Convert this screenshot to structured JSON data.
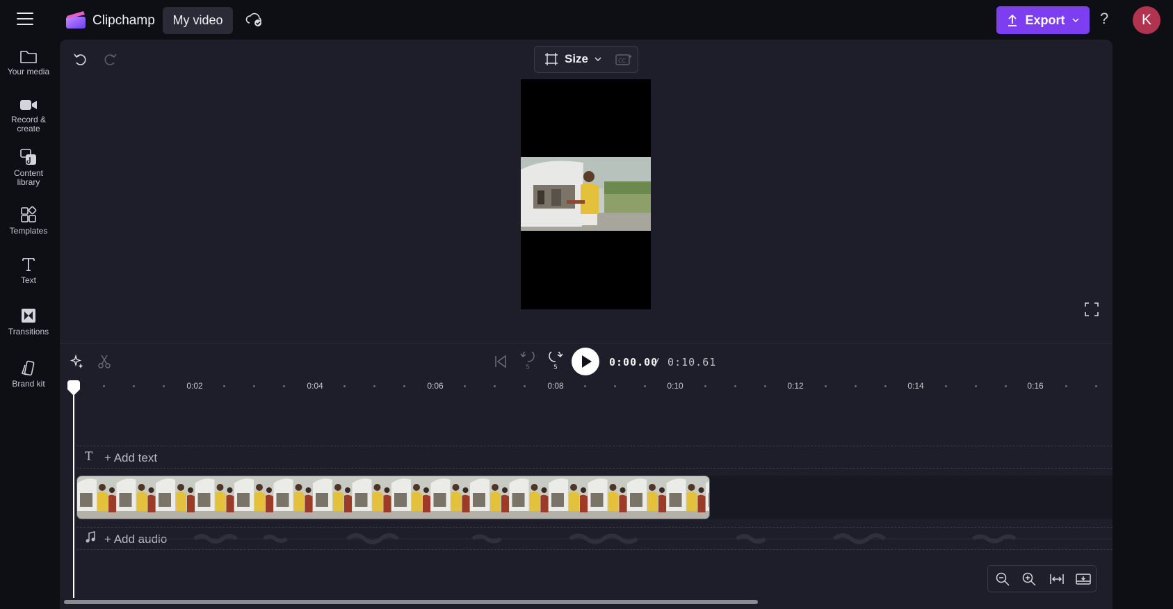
{
  "app": {
    "name": "Clipchamp",
    "project_title": "My video",
    "avatar_initial": "K"
  },
  "topbar": {
    "export_label": "Export",
    "help_label": "?"
  },
  "sidebar": {
    "items": [
      {
        "label": "Your media",
        "icon": "folder-icon"
      },
      {
        "label": "Record & create",
        "icon": "camera-icon"
      },
      {
        "label": "Content library",
        "icon": "content-library-icon"
      },
      {
        "label": "Templates",
        "icon": "templates-icon"
      },
      {
        "label": "Text",
        "icon": "text-icon"
      },
      {
        "label": "Transitions",
        "icon": "transitions-icon"
      },
      {
        "label": "Brand kit",
        "icon": "brand-kit-icon"
      }
    ]
  },
  "preview": {
    "size_label": "Size",
    "aspect": "9:16"
  },
  "playback": {
    "current_time": "0:00.00",
    "total_time": "/ 0:10.61",
    "skip_seconds": "5"
  },
  "timeline": {
    "ruler_labels": [
      "0:02",
      "0:04",
      "0:06",
      "0:08",
      "0:10",
      "0:12",
      "0:14",
      "0:16"
    ],
    "add_text_label": "+ Add text",
    "text_track_icon": "T",
    "add_audio_label": "+ Add audio"
  },
  "colors": {
    "accent": "#7d3df1",
    "avatar": "#b0344f",
    "panel": "#1e1e2a",
    "background": "#0e0e15"
  }
}
